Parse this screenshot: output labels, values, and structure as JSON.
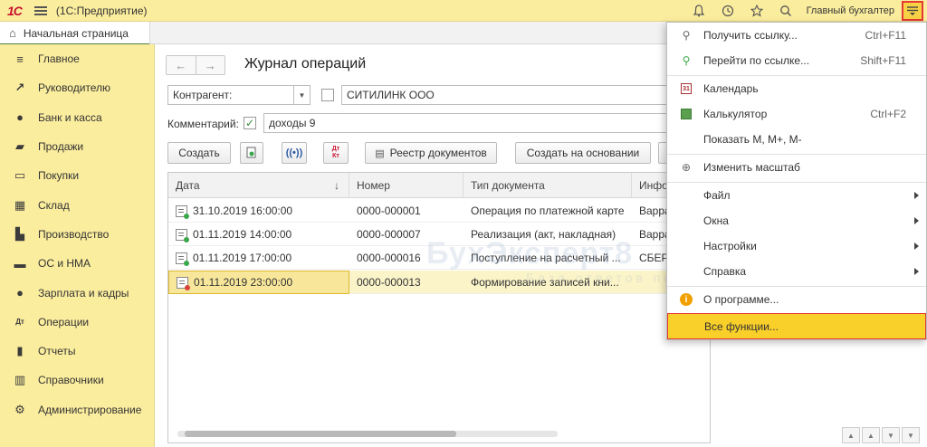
{
  "titlebar": {
    "logo": "1С",
    "app_title": "(1С:Предприятие)",
    "user_name": "Главный бухгалтер",
    "icons": [
      "bell-icon",
      "history-icon",
      "star-icon",
      "search-icon"
    ]
  },
  "tabs": {
    "home_label": "Начальная страница"
  },
  "sidebar": {
    "items": [
      {
        "label": "Главное",
        "icon": "list-icon"
      },
      {
        "label": "Руководителю",
        "icon": "trend-icon"
      },
      {
        "label": "Банк и касса",
        "icon": "coin-icon"
      },
      {
        "label": "Продажи",
        "icon": "bag-icon"
      },
      {
        "label": "Покупки",
        "icon": "cart-icon"
      },
      {
        "label": "Склад",
        "icon": "warehouse-icon"
      },
      {
        "label": "Производство",
        "icon": "factory-icon"
      },
      {
        "label": "ОС и НМА",
        "icon": "truck-icon"
      },
      {
        "label": "Зарплата и кадры",
        "icon": "person-icon"
      },
      {
        "label": "Операции",
        "icon": "dt-kt-icon"
      },
      {
        "label": "Отчеты",
        "icon": "bar-chart-icon"
      },
      {
        "label": "Справочники",
        "icon": "books-icon"
      },
      {
        "label": "Администрирование",
        "icon": "gear-icon"
      }
    ]
  },
  "main": {
    "title": "Журнал операций",
    "contragent_select": "Контрагент:",
    "contragent_value": "СИТИЛИНК ООО",
    "comment_label": "Комментарий:",
    "comment_value": "доходы 9",
    "buttons": {
      "create": "Создать",
      "registry": "Реестр документов",
      "create_based": "Создать на основании",
      "dt_kt": "Дт Кт"
    },
    "table": {
      "headers": [
        "Дата",
        "Номер",
        "Тип документа",
        "Инфо"
      ],
      "rows": [
        {
          "date": "31.10.2019 16:00:00",
          "number": "0000-000001",
          "type": "Операция по платежной карте",
          "info": "Варра"
        },
        {
          "date": "01.11.2019 14:00:00",
          "number": "0000-000007",
          "type": "Реализация (акт, накладная)",
          "info": "Варра"
        },
        {
          "date": "01.11.2019 17:00:00",
          "number": "0000-000016",
          "type": "Поступление на расчетный ...",
          "info": "СБЕР"
        },
        {
          "date": "01.11.2019 23:00:00",
          "number": "0000-000013",
          "type": "Формирование записей кни...",
          "info": ""
        }
      ]
    }
  },
  "watermark": {
    "line1": "БухЭксперт8",
    "line2": "База ответов по учету в 1С"
  },
  "menu": {
    "items": [
      {
        "label": "Получить ссылку...",
        "shortcut": "Ctrl+F11",
        "icon": "link-icon"
      },
      {
        "label": "Перейти по ссылке...",
        "shortcut": "Shift+F11",
        "icon": "goto-link-icon"
      },
      {
        "label": "Календарь",
        "shortcut": "",
        "icon": "calendar-icon"
      },
      {
        "label": "Калькулятор",
        "shortcut": "Ctrl+F2",
        "icon": "calculator-icon"
      },
      {
        "label": "Показать М, М+, М-",
        "shortcut": "",
        "icon": ""
      },
      {
        "label": "Изменить масштаб",
        "shortcut": "",
        "icon": "zoom-icon"
      },
      {
        "label": "Файл",
        "shortcut": "",
        "icon": ""
      },
      {
        "label": "Окна",
        "shortcut": "",
        "icon": ""
      },
      {
        "label": "Настройки",
        "shortcut": "",
        "icon": ""
      },
      {
        "label": "Справка",
        "shortcut": "",
        "icon": ""
      },
      {
        "label": "О программе...",
        "shortcut": "",
        "icon": "info-icon"
      },
      {
        "label": "Все функции...",
        "shortcut": "",
        "icon": ""
      }
    ]
  },
  "colors": {
    "panel_yellow": "#fbed9e",
    "menu_highlight": "#f9cf2a",
    "highlight_border": "#e53935",
    "selected_row": "#fbf4c9"
  }
}
